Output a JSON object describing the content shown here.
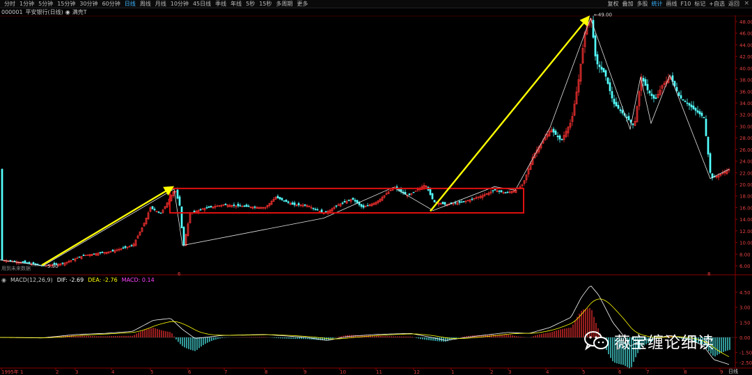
{
  "toolbar": {
    "items": [
      "分时",
      "1分钟",
      "5分钟",
      "15分钟",
      "30分钟",
      "60分钟",
      "日线",
      "周线",
      "月线",
      "10分钟",
      "45日线",
      "季线",
      "年线",
      "5秒",
      "15秒",
      "多周期",
      "更多"
    ],
    "active": "日线",
    "right_items": [
      "复权",
      "叠加",
      "多股",
      "统计",
      "画线",
      "F10",
      "标记",
      "+自选",
      "返回"
    ],
    "close": "×"
  },
  "info": {
    "code": "000001",
    "name": "平安银行(日线)",
    "indicator": "满壳T"
  },
  "main_chart": {
    "price_ticks": [
      "48.00",
      "46.00",
      "44.00",
      "42.00",
      "40.00",
      "38.00",
      "36.00",
      "34.00",
      "32.00",
      "30.00",
      "28.00",
      "26.00",
      "24.00",
      "22.00",
      "20.00",
      "18.00",
      "16.00",
      "14.00",
      "12.00",
      "10.00",
      "8.00",
      "6.00"
    ],
    "high_label": "49.00",
    "low_label": "5.90",
    "left_note": "用到未来数据",
    "mark_left": "6",
    "mark_right": "8"
  },
  "macd": {
    "title": "MACD(12,26,9)",
    "dif": "DIF: -2.69",
    "dea": "DEA: -2.76",
    "macd": "MACD: 0.14",
    "ticks": [
      "4.50",
      "3.00",
      "1.50",
      "0.00",
      "-1.50",
      "-2.50"
    ],
    "colors": {
      "dif": "#ffffff",
      "dea": "#ffff00",
      "macd": "#ff44ff"
    }
  },
  "time_axis": {
    "labels": [
      "1995年 1",
      "2",
      "3",
      "4",
      "5",
      "6",
      "7",
      "8",
      "9",
      "10",
      "11",
      "12",
      "1",
      "2",
      "3",
      "4",
      "5",
      "6",
      "7",
      "8",
      "9"
    ]
  },
  "bottom_tab": "日线",
  "watermark": {
    "text": "薇宝缠论细读",
    "icon": "wechat-icon"
  },
  "colors": {
    "up": "#ff3232",
    "down": "#54ffff",
    "box": "#e01010",
    "arrow": "#ffff00",
    "accent": "#39b4ff"
  }
}
